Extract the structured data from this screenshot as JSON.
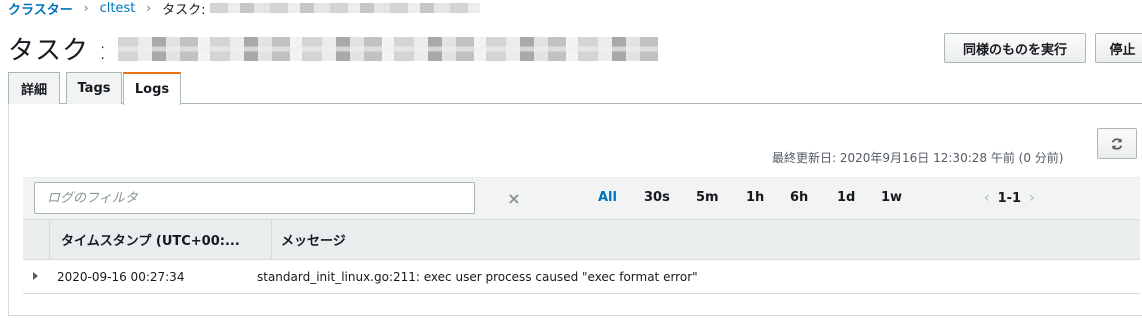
{
  "breadcrumb": {
    "root": "クラスター",
    "cluster": "cltest",
    "current": "タスク:"
  },
  "page": {
    "title": "タスク :"
  },
  "actions": {
    "copy_label": "同様のものを実行",
    "stop_label": "停止"
  },
  "tabs": [
    {
      "label": "詳細"
    },
    {
      "label": "Tags"
    },
    {
      "label": "Logs"
    }
  ],
  "logs": {
    "last_updated": "最終更新日: 2020年9月16日 12:30:28 午前 (0 分前)",
    "filter_placeholder": "ログのフィルタ",
    "ranges": [
      "All",
      "30s",
      "5m",
      "1h",
      "6h",
      "1d",
      "1w"
    ],
    "active_range": "All",
    "pager": {
      "count": "1-1"
    },
    "columns": {
      "timestamp": "タイムスタンプ (UTC+00:...",
      "message": "メッセージ"
    },
    "rows": [
      {
        "timestamp": "2020-09-16 00:27:34",
        "message": "standard_init_linux.go:211: exec user process caused \"exec format error\""
      }
    ]
  },
  "colors": {
    "link": "#0073bb",
    "active_tab_accent": "#ec7211",
    "header_bg": "#f2f3f3",
    "border": "#aab7b8"
  },
  "icons": {
    "refresh": "refresh-icon",
    "clear": "close-icon",
    "expand": "caret-right-icon",
    "prev": "chevron-left-icon",
    "next": "chevron-right-icon"
  }
}
